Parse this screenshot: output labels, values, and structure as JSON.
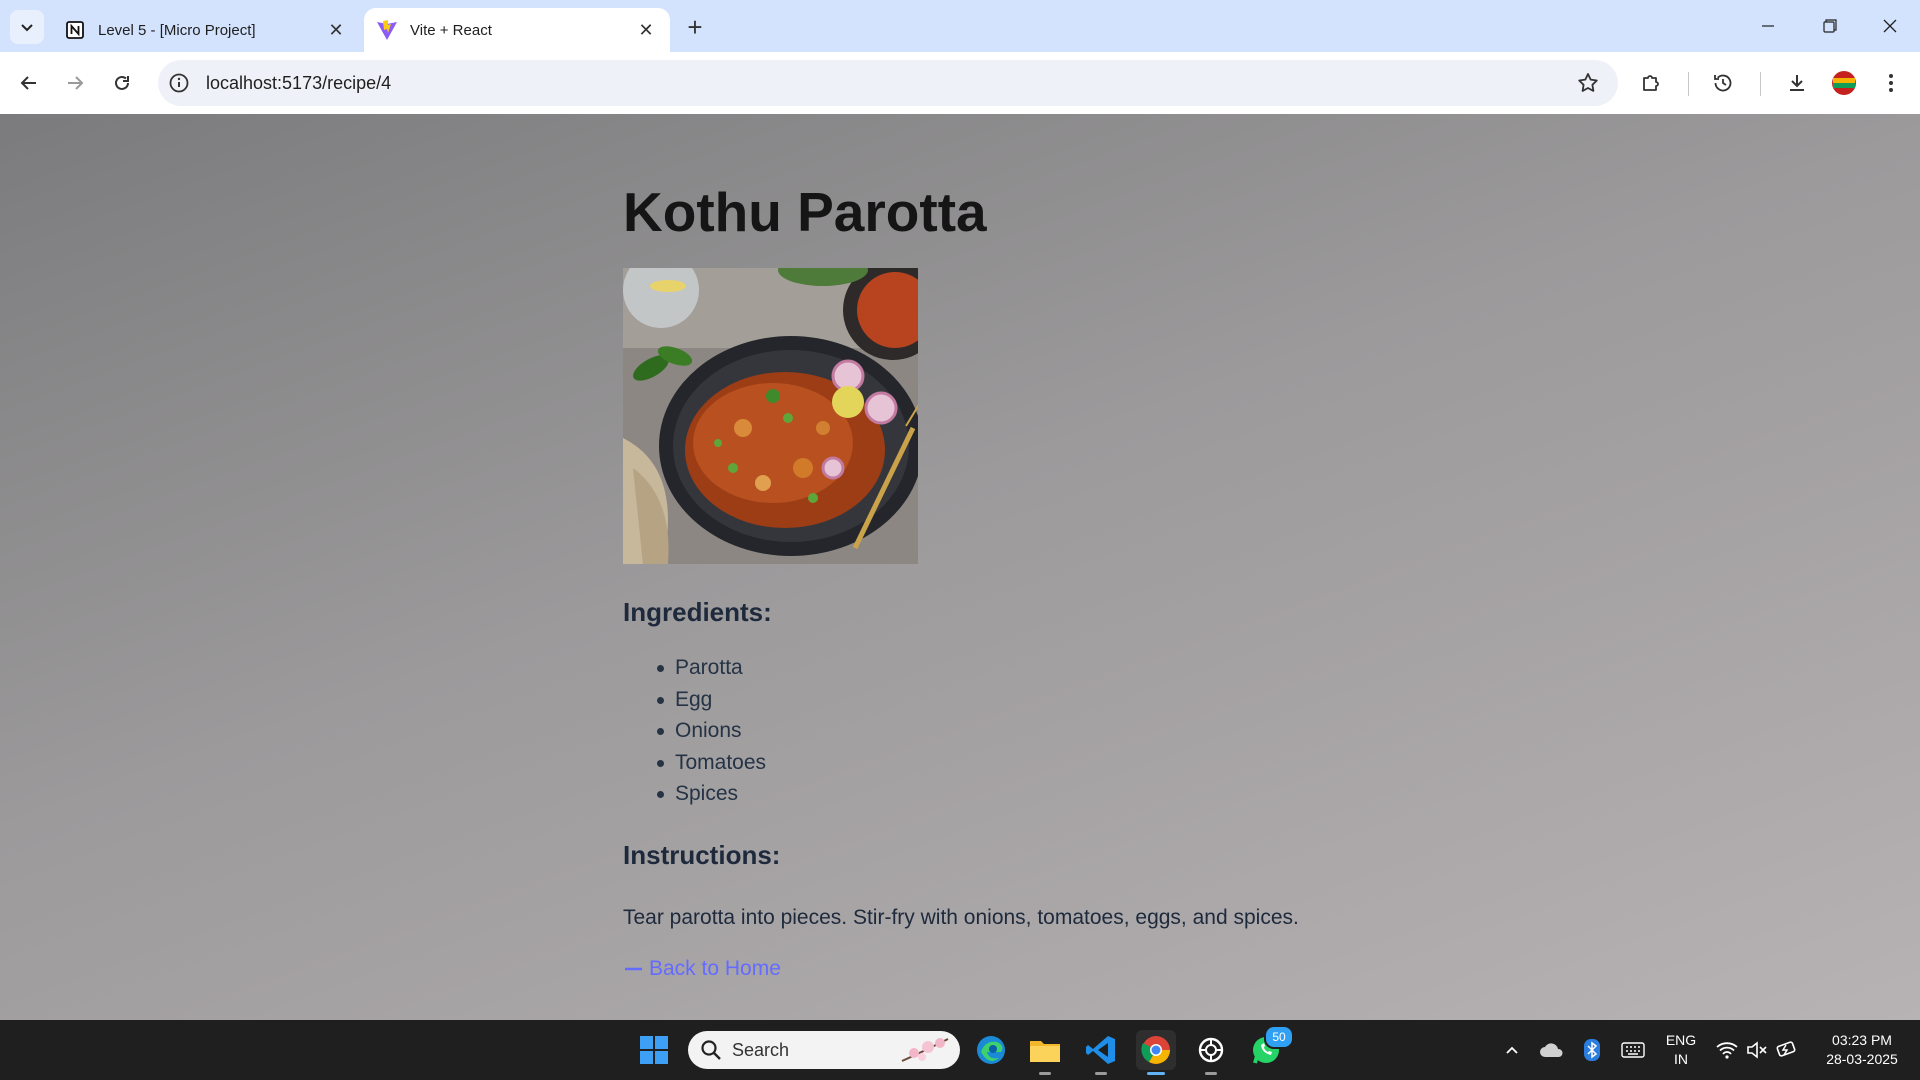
{
  "browser": {
    "tabs": [
      {
        "title": "Level 5 - [Micro Project]",
        "favicon": "notion-icon",
        "active": false
      },
      {
        "title": "Vite + React",
        "favicon": "vite-icon",
        "active": true
      }
    ],
    "url": "localhost:5173/recipe/4"
  },
  "recipe": {
    "title": "Kothu Parotta",
    "image_alt": "Kothu Parotta on a dark plate",
    "ingredients_heading": "Ingredients:",
    "ingredients": [
      "Parotta",
      "Egg",
      "Onions",
      "Tomatoes",
      "Spices"
    ],
    "instructions_heading": "Instructions:",
    "instructions": "Tear parotta into pieces. Stir-fry with onions, tomatoes, eggs, and spices.",
    "back_link": "Back to Home",
    "link_color": "#646cff"
  },
  "taskbar": {
    "search_placeholder": "Search",
    "whatsapp_badge": "50",
    "lang_line1": "ENG",
    "lang_line2": "IN",
    "time": "03:23 PM",
    "date": "28-03-2025"
  }
}
